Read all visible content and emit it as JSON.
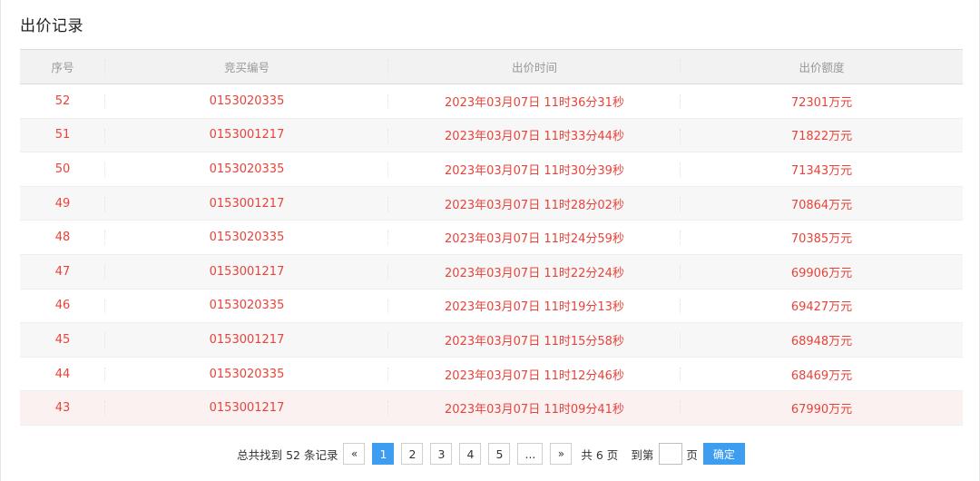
{
  "page": {
    "title": "出价记录"
  },
  "table": {
    "headers": [
      "序号",
      "竞买编号",
      "出价时间",
      "出价额度"
    ],
    "rows": [
      [
        "52",
        "0153020335",
        "2023年03月07日 11时36分31秒",
        "72301万元"
      ],
      [
        "51",
        "0153001217",
        "2023年03月07日 11时33分44秒",
        "71822万元"
      ],
      [
        "50",
        "0153020335",
        "2023年03月07日 11时30分39秒",
        "71343万元"
      ],
      [
        "49",
        "0153001217",
        "2023年03月07日 11时28分02秒",
        "70864万元"
      ],
      [
        "48",
        "0153020335",
        "2023年03月07日 11时24分59秒",
        "70385万元"
      ],
      [
        "47",
        "0153001217",
        "2023年03月07日 11时22分24秒",
        "69906万元"
      ],
      [
        "46",
        "0153020335",
        "2023年03月07日 11时19分13秒",
        "69427万元"
      ],
      [
        "45",
        "0153001217",
        "2023年03月07日 11时15分58秒",
        "68948万元"
      ],
      [
        "44",
        "0153020335",
        "2023年03月07日 11时12分46秒",
        "68469万元"
      ],
      [
        "43",
        "0153001217",
        "2023年03月07日 11时09分41秒",
        "67990万元"
      ]
    ]
  },
  "pagination": {
    "total_text": "总共找到 52 条记录",
    "prev_label": "«",
    "pages": [
      "1",
      "2",
      "3",
      "4",
      "5",
      "..."
    ],
    "active_page": "1",
    "next_label": "»",
    "page_count_text": "共 6 页",
    "goto_prefix": "到第",
    "goto_value": "",
    "goto_suffix": "页",
    "confirm_label": "确定"
  },
  "colors": {
    "row_text": "#e8433a",
    "accent": "#3d9df0",
    "header_bg": "#f2f2f2"
  }
}
